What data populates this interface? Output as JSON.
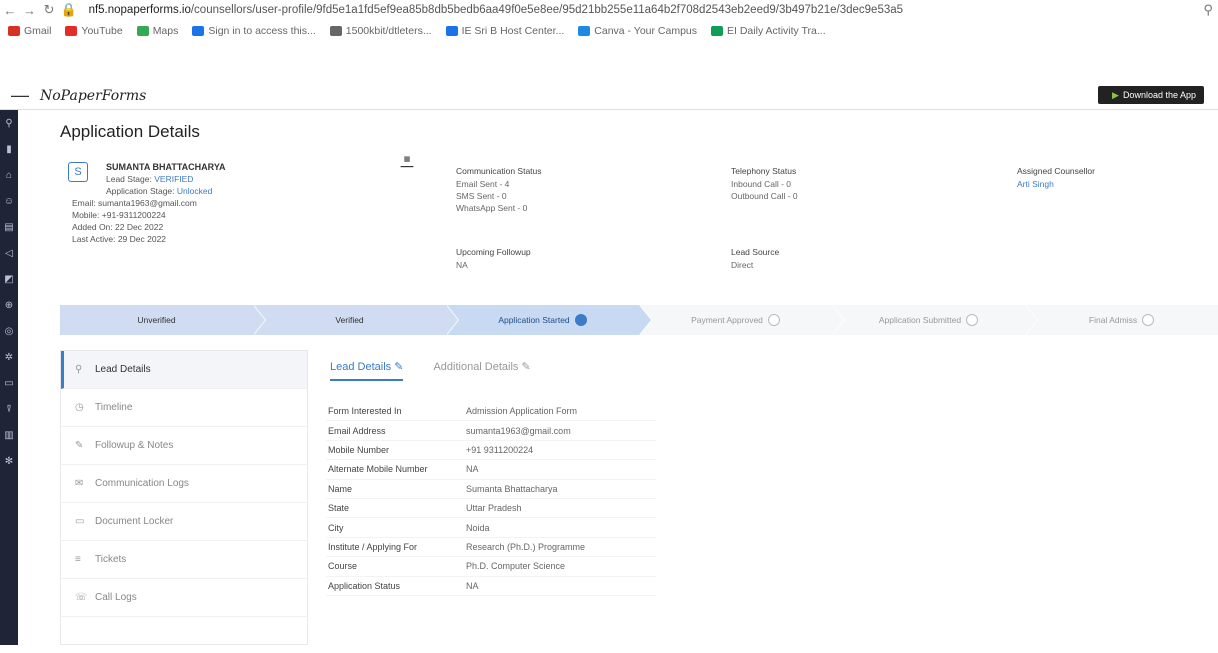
{
  "browser": {
    "url_prefix": "nf5.nopaperforms.io",
    "url_rest": "/counsellors/user-profile/9fd5e1a1fd5ef9ea85b8db5bedb6aa49f0e5e8ee/95d21bb255e11a64b2f708d2543eb2eed9/3b497b21e/3dec9e53a5"
  },
  "bookmarks": [
    {
      "label": "Gmail",
      "color": "#d93025"
    },
    {
      "label": "YouTube",
      "color": "#e52d27"
    },
    {
      "label": "Maps",
      "color": "#34a853"
    },
    {
      "label": "Sign in to access this...",
      "color": "#1a73e8"
    },
    {
      "label": "1500kbit/dtleters...",
      "color": "#666666"
    },
    {
      "label": "IE Sri B Host Center...",
      "color": "#1a73e8"
    },
    {
      "label": "Canva - Your Campus",
      "color": "#1e88e5"
    },
    {
      "label": "EI Daily Activity Tra...",
      "color": "#0f9d58"
    }
  ],
  "app": {
    "logo": "NoPaperForms",
    "download_label": "Download the App"
  },
  "page_title": "Application Details",
  "lead": {
    "avatar": "S",
    "name": "SUMANTA BHATTACHARYA",
    "lead_stage_label": "Lead Stage:",
    "lead_stage_value": "VERIFIED",
    "app_stage_label": "Application Stage:",
    "app_stage_value": "Unlocked",
    "email_line": "Email: sumanta1963@gmail.com",
    "mobile_line": "Mobile: +91-9311200224",
    "added_on": "Added On: 22 Dec 2022",
    "last_active": "Last Active: 29 Dec 2022"
  },
  "columns": {
    "comm_title": "Communication Status",
    "comm_email": "Email Sent - 4",
    "comm_sms": "SMS Sent - 0",
    "comm_wa": "WhatsApp Sent - 0",
    "upcoming_title": "Upcoming Followup",
    "upcoming_val": "NA",
    "tel_title": "Telephony Status",
    "tel_in": "Inbound Call - 0",
    "tel_out": "Outbound Call - 0",
    "source_title": "Lead Source",
    "source_val": "Direct",
    "counsellor_title": "Assigned Counsellor",
    "counsellor_val": "Arti Singh"
  },
  "stages": [
    {
      "label": "Unverified",
      "state": "done"
    },
    {
      "label": "Verified",
      "state": "done"
    },
    {
      "label": "Application Started",
      "state": "active"
    },
    {
      "label": "Payment Approved",
      "state": "todo"
    },
    {
      "label": "Application Submitted",
      "state": "todo"
    },
    {
      "label": "Final Admiss",
      "state": "todo"
    }
  ],
  "menu": [
    {
      "label": "Lead Details",
      "icon": "user-icon",
      "glyph": "⚲",
      "active": true
    },
    {
      "label": "Timeline",
      "icon": "clock-icon",
      "glyph": "◷",
      "active": false
    },
    {
      "label": "Followup & Notes",
      "icon": "notes-icon",
      "glyph": "✎",
      "active": false
    },
    {
      "label": "Communication Logs",
      "icon": "mail-icon",
      "glyph": "✉",
      "active": false
    },
    {
      "label": "Document Locker",
      "icon": "folder-icon",
      "glyph": "▭",
      "active": false
    },
    {
      "label": "Tickets",
      "icon": "ticket-icon",
      "glyph": "≡",
      "active": false
    },
    {
      "label": "Call Logs",
      "icon": "phone-icon",
      "glyph": "☏",
      "active": false
    }
  ],
  "tabs": [
    {
      "label": "Lead Details",
      "active": true
    },
    {
      "label": "Additional Details",
      "active": false
    }
  ],
  "details": [
    {
      "k": "Form Interested In",
      "v": "Admission Application Form"
    },
    {
      "k": "Email Address",
      "v": "sumanta1963@gmail.com"
    },
    {
      "k": "Mobile Number",
      "v": "+91 9311200224"
    },
    {
      "k": "Alternate Mobile Number",
      "v": "NA"
    },
    {
      "k": "Name",
      "v": "Sumanta Bhattacharya"
    },
    {
      "k": "State",
      "v": "Uttar Pradesh"
    },
    {
      "k": "City",
      "v": "Noida"
    },
    {
      "k": "Institute / Applying For",
      "v": "Research (Ph.D.) Programme"
    },
    {
      "k": "Course",
      "v": "Ph.D. Computer Science"
    },
    {
      "k": "Application Status",
      "v": "NA"
    }
  ]
}
